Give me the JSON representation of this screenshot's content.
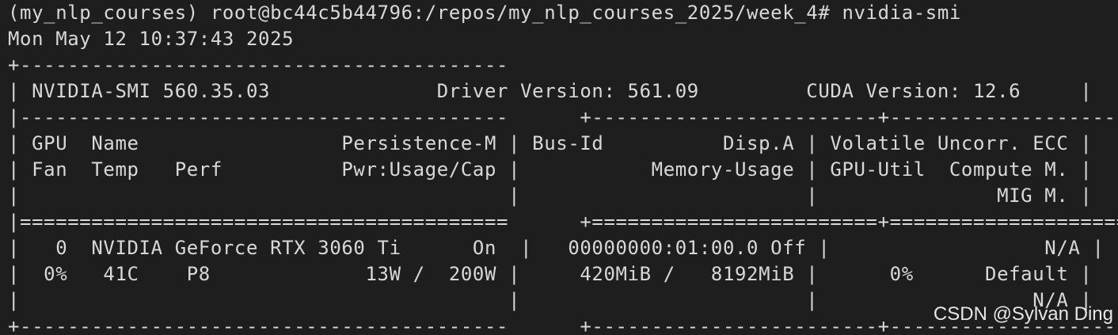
{
  "terminal": {
    "prompt_line": "(my_nlp_courses) root@bc44c5b44796:/repos/my_nlp_courses_2025/week_4# nvidia-smi",
    "timestamp_line": "Mon May 12 10:37:43 2025",
    "table_lines": [
      "+-----------------------------------------                                                            +",
      "| NVIDIA-SMI 560.35.03              Driver Version: 561.09         CUDA Version: 12.6     |",
      "|-----------------------------------------      +------------------------+----------------------+",
      "| GPU  Name                 Persistence-M | Bus-Id          Disp.A | Volatile Uncorr. ECC |",
      "| Fan  Temp   Perf          Pwr:Usage/Cap |           Memory-Usage | GPU-Util  Compute M. |",
      "|                                         |                        |               MIG M. |",
      "|=========================================      +========================+======================|",
      "|   0  NVIDIA GeForce RTX 3060 Ti      On  |   00000000:01:00.0 Off |                  N/A |",
      "|  0%   41C    P8             13W /  200W |     420MiB /   8192MiB |      0%      Default |",
      "|                                         |                        |                  N/A |",
      "+-----------------------------------------      +------------------------+----------------------+"
    ]
  },
  "watermark": "CSDN @Sylvan Ding"
}
